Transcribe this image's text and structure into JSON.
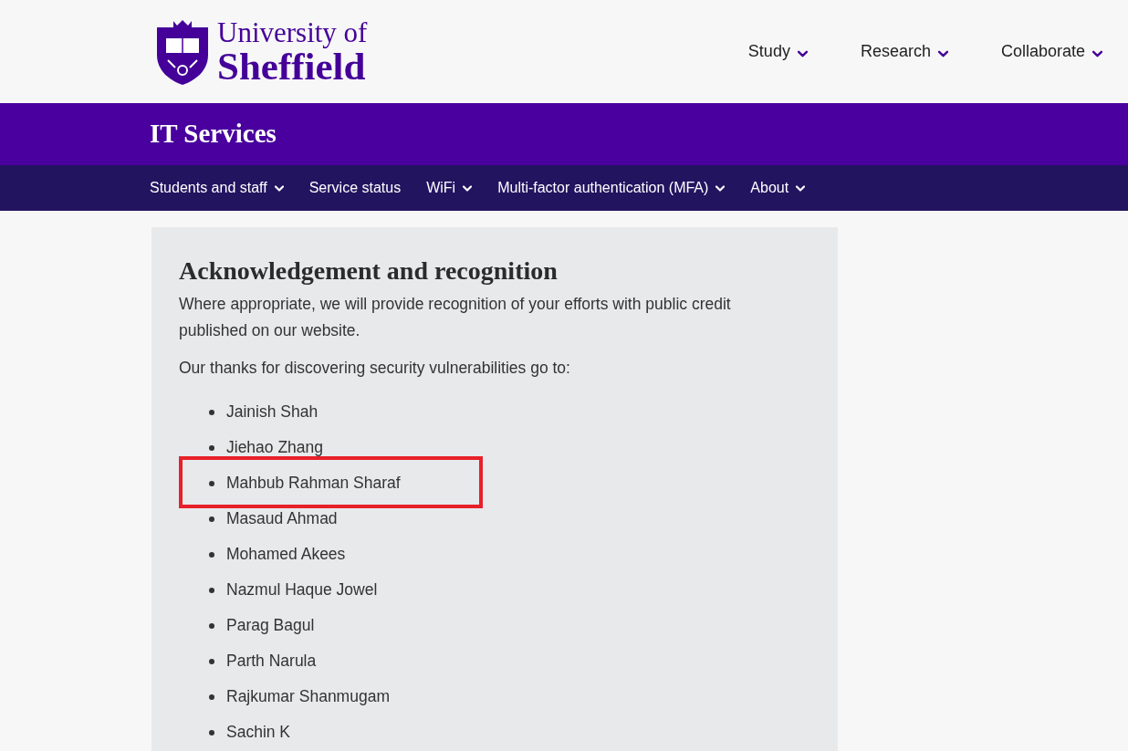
{
  "logo": {
    "line_1": "University of",
    "line_2": "Sheffield"
  },
  "top_nav": [
    {
      "label": "Study"
    },
    {
      "label": "Research"
    },
    {
      "label": "Collaborate"
    }
  ],
  "site_title": "IT Services",
  "section_nav": [
    {
      "label": "Students and staff",
      "dropdown": true
    },
    {
      "label": "Service status",
      "dropdown": false
    },
    {
      "label": "WiFi",
      "dropdown": true
    },
    {
      "label": "Multi-factor authentication (MFA)",
      "dropdown": true
    },
    {
      "label": "About",
      "dropdown": true
    }
  ],
  "content": {
    "heading": "Acknowledgement and recognition",
    "paragraphs": [
      "Where appropriate, we will provide recognition of your efforts with public credit published on our website.",
      "Our thanks for discovering security vulnerabilities go to:"
    ],
    "names": [
      {
        "name": "Jainish Shah",
        "highlighted": false
      },
      {
        "name": "Jiehao Zhang",
        "highlighted": false
      },
      {
        "name": "Mahbub Rahman Sharaf",
        "highlighted": true
      },
      {
        "name": "Masaud Ahmad",
        "highlighted": false
      },
      {
        "name": "Mohamed Akees",
        "highlighted": false
      },
      {
        "name": "Nazmul Haque Jowel",
        "highlighted": false
      },
      {
        "name": "Parag Bagul",
        "highlighted": false
      },
      {
        "name": "Parth Narula",
        "highlighted": false
      },
      {
        "name": "Rajkumar Shanmugam",
        "highlighted": false
      },
      {
        "name": "Sachin K",
        "highlighted": false
      }
    ]
  }
}
